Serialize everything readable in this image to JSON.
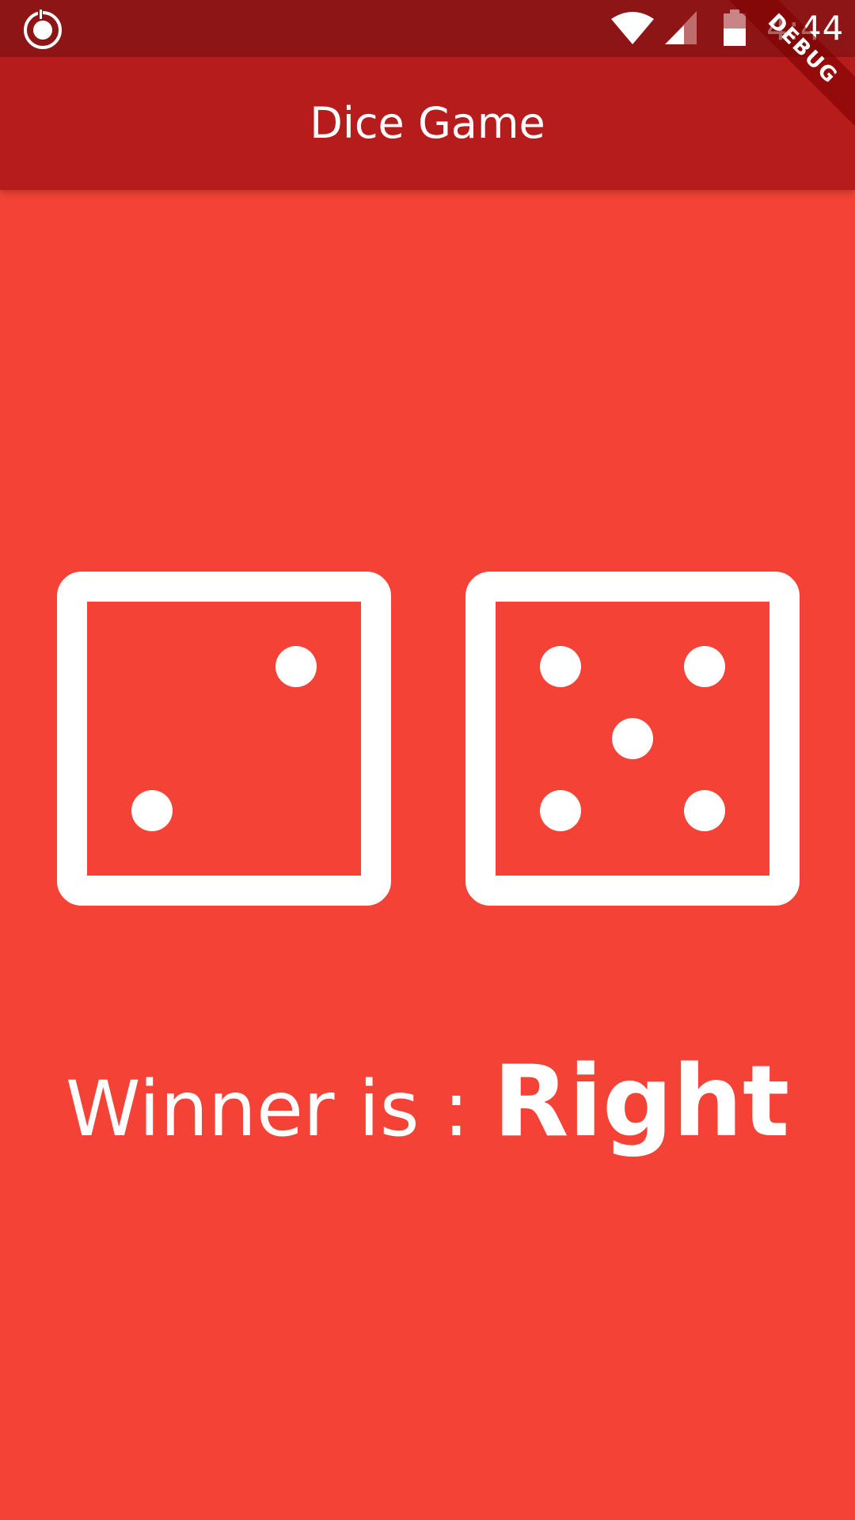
{
  "status_bar": {
    "time": "4:44",
    "icons": [
      "app-notification-icon",
      "wifi-icon",
      "cell-signal-icon",
      "battery-icon"
    ]
  },
  "app_bar": {
    "title": "Dice Game"
  },
  "debug_banner": {
    "label": "DEBUG"
  },
  "dice": {
    "left": {
      "value": 2
    },
    "right": {
      "value": 5
    }
  },
  "winner": {
    "label": "Winner is : ",
    "value": "Right"
  },
  "colors": {
    "background": "#f44336",
    "app_bar": "#b71c1c",
    "status_bar": "#8d1516",
    "foreground": "#ffffff"
  }
}
